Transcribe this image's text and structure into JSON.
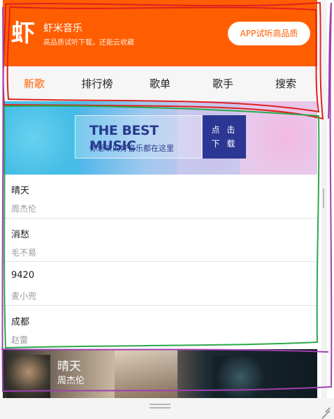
{
  "header": {
    "logo_glyph": "虾",
    "title": "虾米音乐",
    "subtitle": "高品质试听下载，还能云收藏",
    "app_button": "APP试听高品质"
  },
  "nav": {
    "items": [
      {
        "label": "新歌",
        "active": true
      },
      {
        "label": "排行榜",
        "active": false
      },
      {
        "label": "歌单",
        "active": false
      },
      {
        "label": "歌手",
        "active": false
      },
      {
        "label": "搜索",
        "active": false
      }
    ]
  },
  "banner": {
    "title": "THE BEST MUSIC",
    "subtitle": "你想听的好音乐都在这里",
    "button_line1": "点 击",
    "button_line2": "下 载"
  },
  "songs": [
    {
      "name": "晴天",
      "artist": "周杰伦"
    },
    {
      "name": "消愁",
      "artist": "毛不易"
    },
    {
      "name": "9420",
      "artist": "麦小兜"
    },
    {
      "name": "成都",
      "artist": "赵雷"
    }
  ],
  "player": {
    "song": "晴天",
    "artist": "周杰伦"
  },
  "colors": {
    "brand": "#ff5e00",
    "banner_button": "#2b3793",
    "annotation_red": "#e02020",
    "annotation_green": "#2aa84a",
    "annotation_purple": "#a040b0"
  }
}
